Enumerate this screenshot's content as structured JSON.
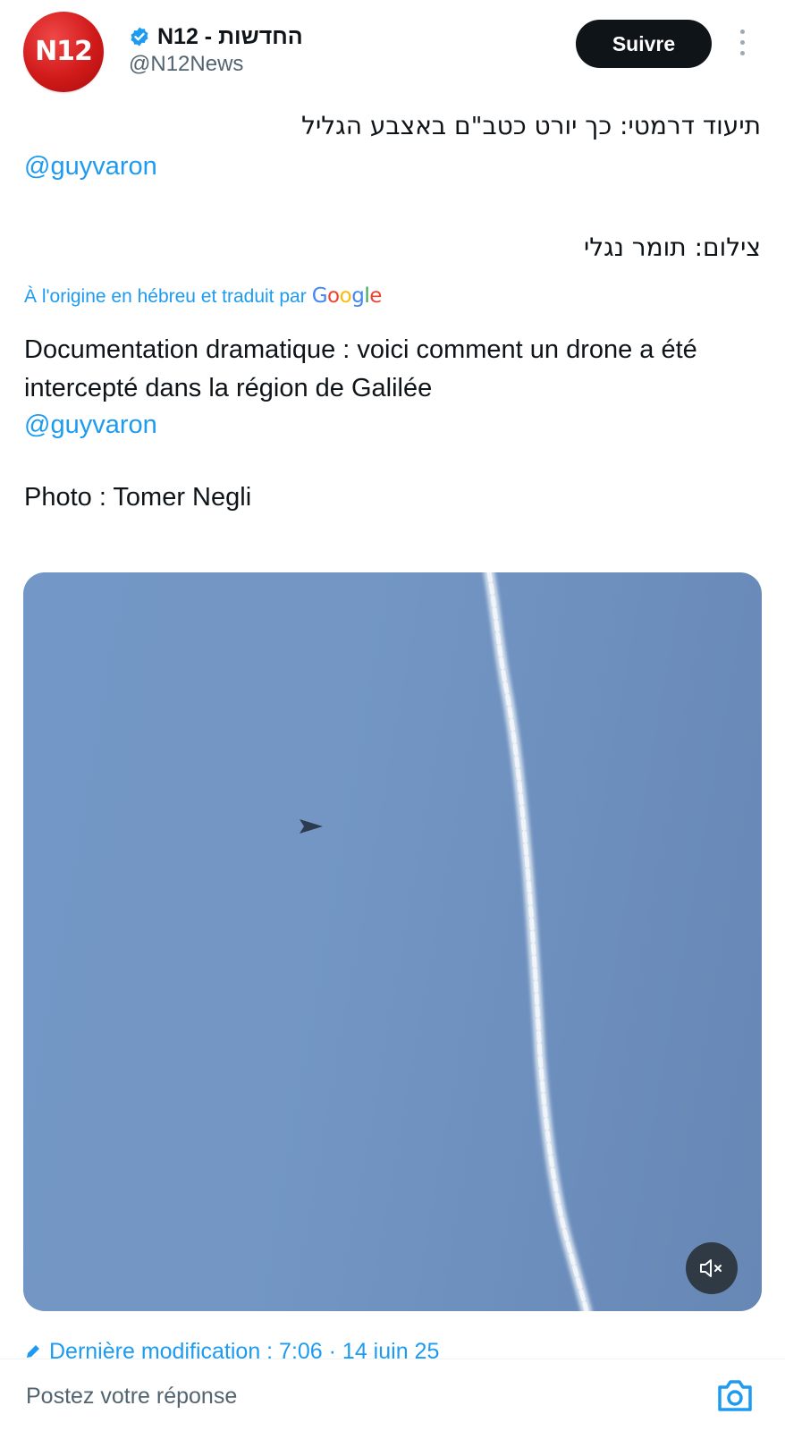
{
  "author": {
    "avatar_text": "N12",
    "display_name": "N12 - החדשות",
    "handle": "@N12News",
    "verified": true,
    "verified_icon": "verified-badge-icon"
  },
  "header": {
    "follow_label": "Suivre",
    "more_icon": "more-vertical-icon"
  },
  "tweet": {
    "original_line1": "תיעוד דרמטי: כך יורט כטב\"ם באצבע הגליל",
    "original_mention": "@guyvaron",
    "original_line2": "צילום: תומר נגלי",
    "translated_note": "À l'origine en hébreu et traduit par",
    "translated_by": "Google",
    "translation_text": "Documentation dramatique : voici comment un drone a été intercepté dans la région de Galilée",
    "translation_mention": "@guyvaron",
    "photo_credit": "Photo : Tomer Negli",
    "edited": "Dernière modification : 7:06 · 14 juin 25"
  },
  "media": {
    "type": "video",
    "mute_icon": "volume-muted-icon"
  },
  "reply": {
    "placeholder": "Postez votre réponse",
    "camera_icon": "camera-icon"
  },
  "colors": {
    "accent": "#1d9bf0",
    "text": "#0f1419",
    "secondary": "#536471",
    "brand_red": "#d11a1a",
    "sky": "#7095c4"
  }
}
